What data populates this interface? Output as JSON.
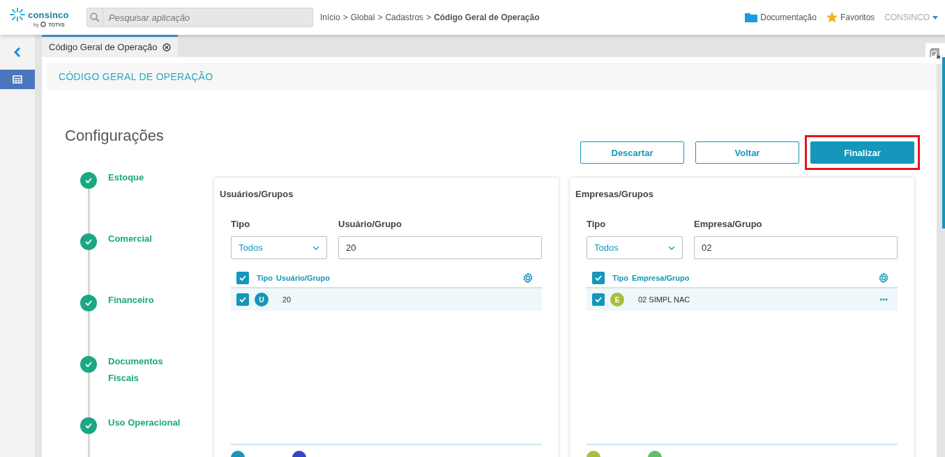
{
  "header": {
    "logo": {
      "name": "consinco",
      "by": "by",
      "brand": "TOTVS"
    },
    "search": {
      "placeholder": "Pesquisar aplicação"
    },
    "breadcrumb": [
      {
        "kind": "link",
        "label": "Início"
      },
      {
        "kind": "separator",
        "label": ">"
      },
      {
        "kind": "link",
        "label": "Global"
      },
      {
        "kind": "separator",
        "label": ">"
      },
      {
        "kind": "link",
        "label": "Cadastros"
      },
      {
        "kind": "separator",
        "label": ">"
      },
      {
        "kind": "current",
        "label": "Código Geral de Operação"
      }
    ],
    "links": [
      {
        "kind": "folder",
        "label": "Documentação"
      },
      {
        "kind": "star",
        "label": "Favoritos"
      }
    ],
    "user": {
      "name": "CONSINCO"
    }
  },
  "sidebar": {
    "items": [
      {
        "kind": "table",
        "selected": true
      }
    ]
  },
  "tabs": [
    {
      "label": "Código Geral de Operação",
      "selected": true
    }
  ],
  "page_title": "CÓDIGO GERAL DE OPERAÇÃO",
  "section_title": "Configurações",
  "steps": [
    {
      "label": "Estoque",
      "done": true
    },
    {
      "label": "Comercial",
      "done": true
    },
    {
      "label": "Financeiro",
      "done": true
    },
    {
      "label": "Documentos Fiscais",
      "done": true
    },
    {
      "label": "Uso Operacional",
      "done": true
    }
  ],
  "buttons": [
    {
      "label": "Descartar",
      "kind": "outline",
      "highlighted": false
    },
    {
      "label": "Voltar",
      "kind": "outline",
      "highlighted": false
    },
    {
      "label": "Finalizar",
      "kind": "primary",
      "highlighted": true
    }
  ],
  "cards": [
    {
      "title": "Usuários/Grupos",
      "type_label": "Tipo",
      "type_value": "Todos",
      "filter_label": "Usuário/Grupo",
      "filter_value": "20",
      "all_checked": true,
      "columns": [
        "Tipo",
        "Usuário/Grupo"
      ],
      "rows": [
        {
          "checked": true,
          "badge": "U",
          "color": "#1596bb",
          "name": "20",
          "menu": false
        }
      ],
      "legend": [
        {
          "color": "#1596bb"
        },
        {
          "color": "#3546c4"
        }
      ]
    },
    {
      "title": "Empresas/Grupos",
      "type_label": "Tipo",
      "type_value": "Todos",
      "filter_label": "Empresa/Grupo",
      "filter_value": "02",
      "all_checked": true,
      "columns": [
        "Tipo",
        "Empresa/Grupo"
      ],
      "rows": [
        {
          "checked": true,
          "badge": "E",
          "color": "#a9bf3b",
          "name": "02 SIMPL NAC",
          "menu": true
        }
      ],
      "legend": [
        {
          "color": "#a9bf3b"
        },
        {
          "color": "#5cbf6e"
        }
      ]
    }
  ]
}
